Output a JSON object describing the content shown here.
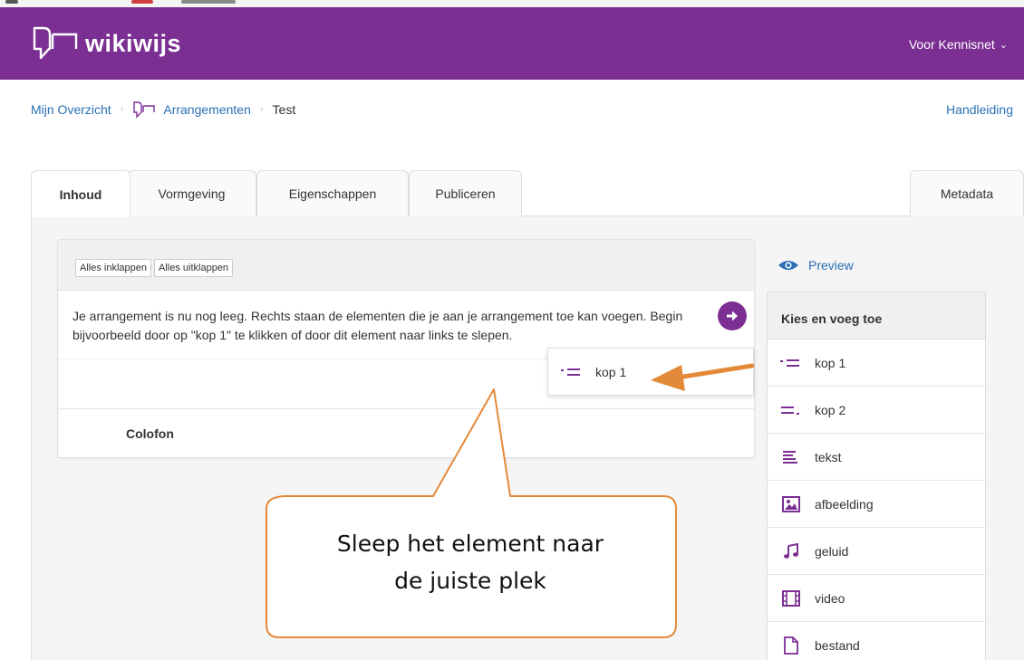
{
  "app": {
    "name": "wikiwijs",
    "user_menu": "Voor Kennisnet",
    "accent_color": "#7b2f93",
    "link_color": "#2a6fb5",
    "arrow_color": "#e38a3a"
  },
  "breadcrumb": {
    "items": [
      "Mijn Overzicht",
      "Arrangementen",
      "Test"
    ],
    "help": "Handleiding"
  },
  "tabs": [
    "Inhoud",
    "Vormgeving",
    "Eigenschappen",
    "Publiceren",
    "Metadata"
  ],
  "active_tab": "Inhoud",
  "editor": {
    "collapse_all": "Alles inklappen",
    "expand_all": "Alles uitklappen",
    "empty_message": "Je arrangement is nu nog leeg. Rechts staan de elementen die je aan je arrangement toe kan voegen. Begin bijvoorbeeld door op \"kop 1\" te klikken of door dit element naar links te slepen.",
    "colofon": "Colofon",
    "dragged_item": "kop 1"
  },
  "sidebar": {
    "preview": "Preview",
    "title": "Kies en voeg toe",
    "items": [
      {
        "label": "kop 1",
        "icon": "heading-1-icon"
      },
      {
        "label": "kop 2",
        "icon": "heading-2-icon"
      },
      {
        "label": "tekst",
        "icon": "text-icon"
      },
      {
        "label": "afbeelding",
        "icon": "image-icon"
      },
      {
        "label": "geluid",
        "icon": "music-note-icon"
      },
      {
        "label": "video",
        "icon": "film-icon"
      },
      {
        "label": "bestand",
        "icon": "file-icon"
      }
    ]
  },
  "callout": {
    "line1": "Sleep het element naar",
    "line2": "de juiste plek"
  }
}
